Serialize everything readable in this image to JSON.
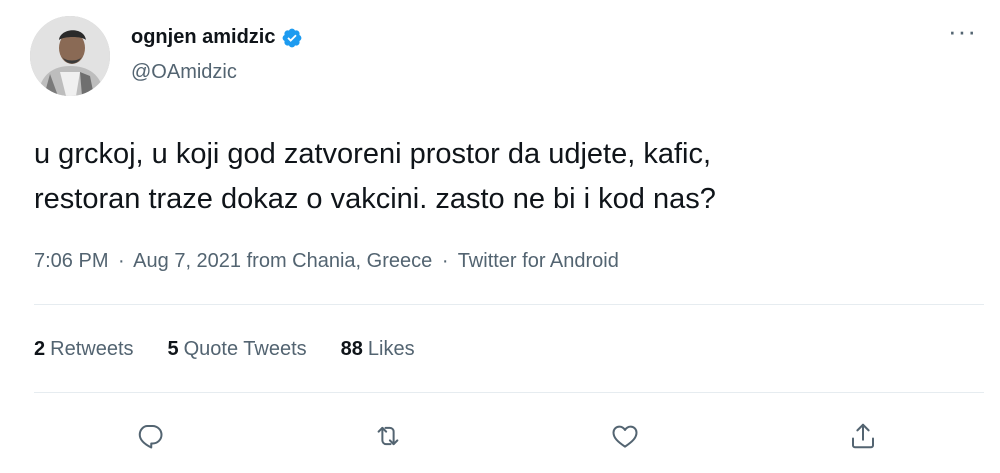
{
  "author": {
    "display_name": "ognjen amidzic",
    "handle": "@OAmidzic",
    "verified_icon": "verified-badge-icon",
    "avatar_icon": "avatar"
  },
  "menu": {
    "more_label": "···"
  },
  "tweet": {
    "text": "u grckoj, u koji god zatvoreni prostor da udjete, kafic,\nrestoran traze dokaz o vakcini. zasto ne bi i kod nas?",
    "time": "7:06 PM",
    "date": "Aug 7, 2021",
    "location": "from Chania, Greece",
    "source": "Twitter for Android",
    "separator": "·"
  },
  "stats": {
    "retweets_count": "2",
    "retweets_label": "Retweets",
    "quotes_count": "5",
    "quotes_label": "Quote Tweets",
    "likes_count": "88",
    "likes_label": "Likes"
  },
  "actions": [
    "reply-icon",
    "retweet-icon",
    "like-icon",
    "share-icon"
  ],
  "colors": {
    "text_primary": "#0f1419",
    "text_secondary": "#536471",
    "verified": "#1d9bf0",
    "divider": "#e6ecf0"
  }
}
